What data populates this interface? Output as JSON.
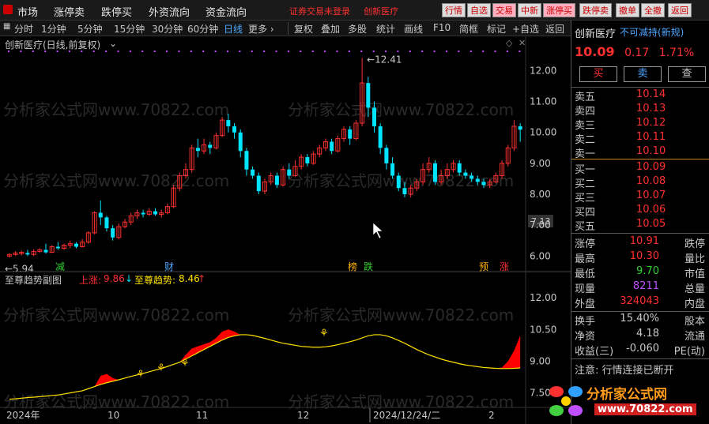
{
  "menubar": {
    "items": [
      "市场",
      "涨停卖",
      "跌停买",
      "外资流向",
      "资金流向"
    ],
    "status": "证券交易未登录",
    "stock": "创新医疗",
    "buttons": [
      "行情",
      "自选",
      "交易",
      "中新",
      "涨停买",
      "跌停卖",
      "撤单",
      "全撤",
      "返回"
    ]
  },
  "toolbar": {
    "periods": [
      "分时",
      "1分钟",
      "5分钟",
      "15分钟",
      "30分钟",
      "60分钟",
      "日线",
      "更多 ›"
    ],
    "active": "日线",
    "tools": [
      "复权",
      "叠加",
      "多股",
      "统计",
      "画线",
      "F10",
      "简框",
      "标记",
      "+自选",
      "返回"
    ]
  },
  "chart": {
    "title": "创新医疗(日线,前复权)",
    "high_label": "12.41",
    "low_label": "5.94",
    "last_price": "7.13",
    "price_ticks": [
      "12.00",
      "11.00",
      "10.00",
      "9.00",
      "8.00",
      "7.00",
      "6.00"
    ],
    "markers": [
      "减",
      "财",
      "榜",
      "跌",
      "预",
      "涨"
    ],
    "date_labels": [
      "2024年",
      "10",
      "11",
      "12",
      "2024/12/24/二",
      "2"
    ],
    "watermark": "分析家公式网www.70822.com"
  },
  "indicator": {
    "title": "至尊趋势副图",
    "rise_label": "上涨:",
    "rise_value": "9.86",
    "trend_label": "至尊趋势:",
    "trend_value": "8.46",
    "ticks": [
      "12.00",
      "10.50",
      "9.00",
      "7.50"
    ]
  },
  "right_panel": {
    "name": "创新医疗",
    "tag": "不可减持(新规)",
    "price": "10.09",
    "change": "0.17",
    "pct": "1.71%",
    "buy_label": "买",
    "sell_label": "卖",
    "query_label": "查",
    "sells": [
      {
        "label": "卖五",
        "price": "10.14",
        "vol": ""
      },
      {
        "label": "卖四",
        "price": "10.13",
        "vol": ""
      },
      {
        "label": "卖三",
        "price": "10.12",
        "vol": ""
      },
      {
        "label": "卖二",
        "price": "10.11",
        "vol": ""
      },
      {
        "label": "卖一",
        "price": "10.10",
        "vol": ""
      }
    ],
    "buys": [
      {
        "label": "买一",
        "price": "10.09",
        "vol": ""
      },
      {
        "label": "买二",
        "price": "10.08",
        "vol": ""
      },
      {
        "label": "买三",
        "price": "10.07",
        "vol": ""
      },
      {
        "label": "买四",
        "price": "10.06",
        "vol": ""
      },
      {
        "label": "买五",
        "price": "10.05",
        "vol": ""
      }
    ],
    "stats": [
      {
        "k1": "涨停",
        "v1": "10.91",
        "k2": "跌停",
        "color": "#ff3030"
      },
      {
        "k1": "最高",
        "v1": "10.30",
        "k2": "量比",
        "color": "#ff3030"
      },
      {
        "k1": "最低",
        "v1": "9.70",
        "k2": "市值",
        "color": "#30d030"
      },
      {
        "k1": "现量",
        "v1": "8211",
        "k2": "总量",
        "color": "#c050ff"
      },
      {
        "k1": "外盘",
        "v1": "324043",
        "k2": "内盘",
        "color": "#ff3030"
      }
    ],
    "stats2": [
      {
        "k1": "换手",
        "v1": "15.40%",
        "k2": "股本",
        "color": "#c8c8c8"
      },
      {
        "k1": "净资",
        "v1": "4.18",
        "k2": "流通",
        "color": "#c8c8c8"
      },
      {
        "k1": "收益(三)",
        "v1": "-0.060",
        "k2": "PE(动)",
        "color": "#c8c8c8"
      }
    ],
    "notice": "注意: 行情连接已断开"
  },
  "logo": {
    "text": "分析家公式网",
    "url": "www.70822.com"
  },
  "colors": {
    "up": "#ff3030",
    "down": "#00e5ff",
    "trend": "#ffe000",
    "fill": "#ff0000"
  },
  "chart_data": {
    "type": "candlestick",
    "y_range": [
      5.7,
      12.6
    ],
    "candles": [
      [
        6.0,
        6.05,
        5.95,
        6.08
      ],
      [
        6.05,
        6.1,
        6.0,
        6.15
      ],
      [
        6.08,
        6.12,
        6.02,
        6.18
      ],
      [
        6.1,
        6.05,
        6.0,
        6.2
      ],
      [
        6.05,
        6.15,
        6.0,
        6.22
      ],
      [
        6.15,
        6.2,
        6.1,
        6.25
      ],
      [
        6.2,
        6.12,
        6.08,
        6.4
      ],
      [
        6.12,
        6.3,
        6.1,
        6.35
      ],
      [
        6.3,
        6.25,
        6.2,
        6.45
      ],
      [
        6.25,
        6.35,
        6.2,
        6.4
      ],
      [
        6.35,
        6.4,
        6.25,
        6.5
      ],
      [
        6.4,
        6.3,
        6.25,
        6.45
      ],
      [
        6.3,
        6.45,
        6.28,
        6.55
      ],
      [
        6.45,
        6.75,
        6.4,
        6.8
      ],
      [
        6.75,
        7.4,
        6.7,
        7.45
      ],
      [
        7.4,
        7.25,
        7.0,
        7.8
      ],
      [
        7.25,
        6.9,
        6.8,
        7.3
      ],
      [
        6.9,
        6.6,
        6.5,
        7.0
      ],
      [
        6.6,
        6.95,
        6.55,
        7.05
      ],
      [
        6.95,
        7.1,
        6.9,
        7.2
      ],
      [
        7.1,
        7.3,
        7.0,
        7.4
      ],
      [
        7.3,
        7.4,
        7.2,
        7.5
      ],
      [
        7.4,
        7.35,
        7.25,
        7.5
      ],
      [
        7.35,
        7.45,
        7.3,
        7.55
      ],
      [
        7.45,
        7.35,
        7.3,
        7.55
      ],
      [
        7.35,
        7.4,
        7.25,
        7.5
      ],
      [
        7.4,
        7.6,
        7.35,
        7.7
      ],
      [
        7.6,
        8.2,
        7.55,
        8.3
      ],
      [
        8.2,
        8.6,
        8.1,
        8.7
      ],
      [
        8.6,
        8.8,
        8.5,
        9.0
      ],
      [
        8.8,
        9.5,
        8.7,
        9.6
      ],
      [
        9.5,
        9.4,
        9.2,
        9.8
      ],
      [
        9.4,
        9.6,
        9.3,
        9.8
      ],
      [
        9.6,
        9.5,
        9.3,
        9.7
      ],
      [
        9.5,
        9.9,
        9.45,
        10.0
      ],
      [
        9.9,
        10.4,
        9.85,
        10.5
      ],
      [
        10.4,
        10.2,
        10.0,
        10.6
      ],
      [
        10.2,
        10.0,
        9.8,
        10.3
      ],
      [
        10.0,
        9.4,
        9.2,
        10.1
      ],
      [
        9.4,
        8.8,
        8.6,
        9.5
      ],
      [
        8.8,
        8.6,
        8.5,
        8.9
      ],
      [
        8.6,
        8.1,
        8.0,
        8.7
      ],
      [
        8.1,
        8.4,
        8.0,
        8.5
      ],
      [
        8.4,
        8.6,
        8.3,
        8.7
      ],
      [
        8.6,
        8.3,
        8.2,
        8.7
      ],
      [
        8.3,
        8.8,
        8.25,
        8.9
      ],
      [
        8.8,
        8.6,
        8.5,
        9.0
      ],
      [
        8.6,
        8.9,
        8.55,
        9.1
      ],
      [
        8.9,
        9.2,
        8.8,
        9.3
      ],
      [
        9.2,
        9.0,
        8.9,
        9.3
      ],
      [
        9.0,
        9.3,
        8.95,
        9.4
      ],
      [
        9.3,
        9.5,
        9.2,
        9.6
      ],
      [
        9.5,
        9.7,
        9.4,
        9.8
      ],
      [
        9.7,
        9.4,
        9.3,
        9.8
      ],
      [
        9.4,
        9.8,
        9.35,
        9.9
      ],
      [
        9.8,
        10.1,
        9.7,
        10.2
      ],
      [
        10.1,
        9.8,
        9.6,
        10.2
      ],
      [
        9.8,
        10.3,
        9.75,
        10.4
      ],
      [
        10.3,
        11.6,
        10.2,
        12.41
      ],
      [
        11.6,
        10.8,
        10.5,
        11.8
      ],
      [
        10.8,
        10.2,
        10.0,
        11.0
      ],
      [
        10.2,
        9.5,
        9.3,
        10.3
      ],
      [
        9.5,
        9.0,
        8.8,
        9.6
      ],
      [
        9.0,
        8.6,
        8.5,
        9.2
      ],
      [
        8.6,
        8.2,
        8.1,
        8.7
      ],
      [
        8.2,
        8.0,
        7.9,
        8.4
      ],
      [
        8.0,
        8.2,
        7.9,
        8.3
      ],
      [
        8.2,
        8.4,
        8.1,
        8.5
      ],
      [
        8.4,
        8.8,
        8.3,
        9.0
      ],
      [
        8.8,
        9.0,
        8.7,
        9.2
      ],
      [
        9.0,
        8.4,
        8.3,
        9.1
      ],
      [
        8.4,
        8.6,
        8.3,
        8.8
      ],
      [
        8.6,
        8.8,
        8.5,
        9.0
      ],
      [
        8.8,
        9.0,
        8.7,
        9.1
      ],
      [
        9.0,
        8.7,
        8.6,
        9.1
      ],
      [
        8.7,
        8.6,
        8.5,
        8.8
      ],
      [
        8.6,
        8.5,
        8.4,
        8.7
      ],
      [
        8.5,
        8.4,
        8.3,
        8.6
      ],
      [
        8.4,
        8.3,
        8.2,
        8.5
      ],
      [
        8.3,
        8.4,
        8.2,
        8.5
      ],
      [
        8.4,
        8.6,
        8.35,
        8.7
      ],
      [
        8.6,
        9.0,
        8.5,
        9.1
      ],
      [
        9.0,
        9.5,
        8.9,
        9.6
      ],
      [
        9.5,
        10.2,
        9.4,
        10.4
      ],
      [
        10.2,
        10.09,
        9.7,
        10.3
      ]
    ],
    "indicator": {
      "y_range": [
        7.0,
        12.6
      ],
      "trend": [
        7.2,
        7.22,
        7.25,
        7.28,
        7.3,
        7.32,
        7.35,
        7.38,
        7.4,
        7.45,
        7.5,
        7.55,
        7.6,
        7.7,
        7.8,
        7.9,
        7.98,
        8.05,
        8.12,
        8.2,
        8.28,
        8.35,
        8.42,
        8.5,
        8.58,
        8.65,
        8.75,
        8.85,
        8.95,
        9.1,
        9.25,
        9.4,
        9.55,
        9.7,
        9.85,
        10.0,
        10.12,
        10.2,
        10.25,
        10.25,
        10.22,
        10.15,
        10.08,
        10.0,
        9.92,
        9.85,
        9.8,
        9.75,
        9.7,
        9.68,
        9.66,
        9.66,
        9.68,
        9.72,
        9.78,
        9.85,
        9.92,
        10.0,
        10.1,
        10.2,
        10.25,
        10.25,
        10.2,
        10.1,
        9.98,
        9.85,
        9.7,
        9.55,
        9.42,
        9.3,
        9.2,
        9.1,
        9.02,
        8.95,
        8.88,
        8.82,
        8.78,
        8.74,
        8.7,
        8.68,
        8.66,
        8.65,
        8.65,
        8.66,
        8.68
      ],
      "upper": [
        7.2,
        7.22,
        7.25,
        7.28,
        7.3,
        7.32,
        7.35,
        7.38,
        7.4,
        7.45,
        7.5,
        7.55,
        7.6,
        7.7,
        7.8,
        8.3,
        8.4,
        8.2,
        8.12,
        8.2,
        8.28,
        8.35,
        8.42,
        8.5,
        8.58,
        8.65,
        8.75,
        8.85,
        8.95,
        9.3,
        9.6,
        9.7,
        9.8,
        9.9,
        10.1,
        10.4,
        10.5,
        10.4,
        10.25,
        10.25,
        10.22,
        10.15,
        10.08,
        10.0,
        9.92,
        9.85,
        9.8,
        9.75,
        9.7,
        9.68,
        9.66,
        9.66,
        9.68,
        9.72,
        9.78,
        9.85,
        9.92,
        10.0,
        10.1,
        10.2,
        10.25,
        10.25,
        10.2,
        10.1,
        9.98,
        9.85,
        9.7,
        9.55,
        9.42,
        9.3,
        9.2,
        9.1,
        9.02,
        8.95,
        8.88,
        8.82,
        8.78,
        8.74,
        8.7,
        8.68,
        8.66,
        8.7,
        9.0,
        9.5,
        10.2
      ]
    }
  }
}
